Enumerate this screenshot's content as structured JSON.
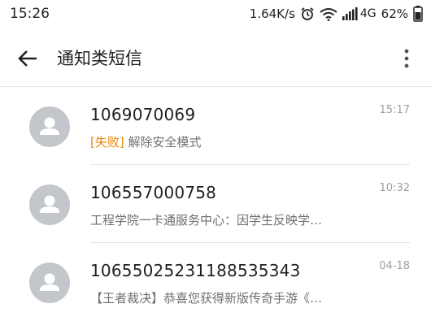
{
  "status_bar": {
    "time": "15:26",
    "net_speed": "1.64K/s",
    "alarm_icon": "alarm-clock-icon",
    "wifi_icon": "wifi-icon",
    "signal_icon": "cell-signal-icon",
    "network_type": "4G",
    "battery_percent": "62%",
    "battery_icon": "battery-icon"
  },
  "app_bar": {
    "back_icon": "back-arrow-icon",
    "title": "通知类短信",
    "more_icon": "more-vertical-icon"
  },
  "messages": [
    {
      "sender": "1069070069",
      "time": "15:17",
      "tag": "[失败]",
      "preview": " 解除安全模式",
      "avatar_icon": "person-avatar-icon"
    },
    {
      "sender": "106557000758",
      "time": "10:32",
      "tag": "",
      "preview": "工程学院一卡通服务中心：因学生反映学…",
      "avatar_icon": "person-avatar-icon"
    },
    {
      "sender": "10655025231188535343",
      "time": "04-18",
      "tag": "",
      "preview": "【王者裁决】恭喜您获得新版传奇手游《…",
      "avatar_icon": "person-avatar-icon"
    }
  ],
  "colors": {
    "fail_tag": "#e8860f",
    "avatar_bg": "#c3c7cc",
    "secondary_text": "#6f6f6f",
    "time_text": "#9e9e9e"
  }
}
